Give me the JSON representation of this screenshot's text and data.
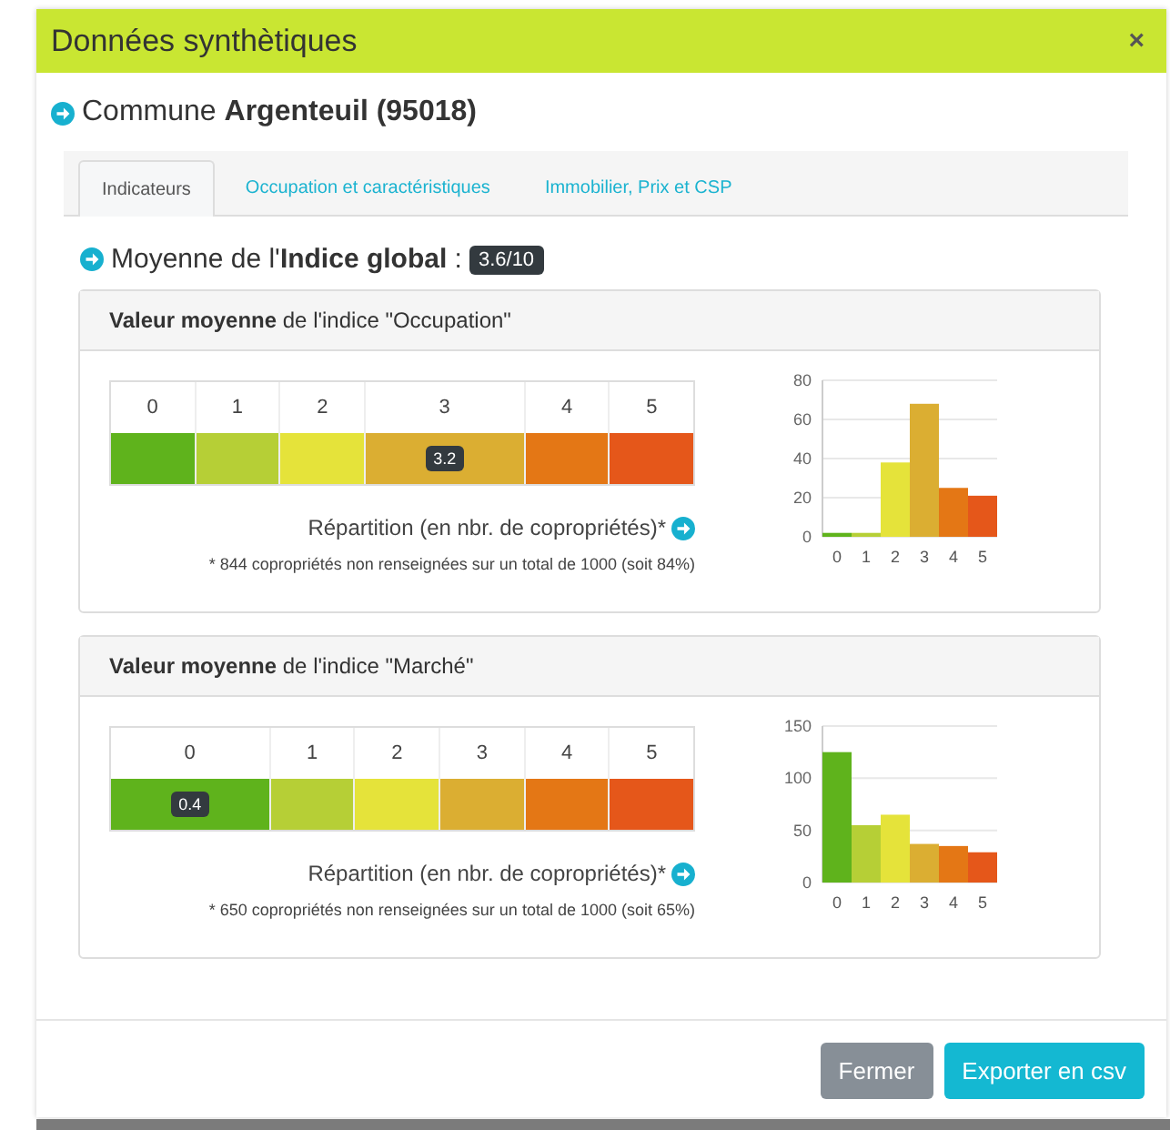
{
  "window": {
    "title": "Données synthètiques",
    "close": "×"
  },
  "commune": {
    "prefix": "Commune",
    "name": "Argenteuil (95018)"
  },
  "tabs": [
    {
      "label": "Indicateurs",
      "selected": true
    },
    {
      "label": "Occupation et caractéristiques",
      "selected": false
    },
    {
      "label": "Immobilier, Prix et CSP",
      "selected": false
    }
  ],
  "global": {
    "text": "Moyenne de l'**Indice global** :",
    "badge": "3.6/10"
  },
  "panels": [
    {
      "title": "**Valeur moyenne** de l'indice \"Occupation\"",
      "marker": "3.2",
      "cells": [
        {
          "label": "0",
          "color": "#5fb31c",
          "selected": false
        },
        {
          "label": "1",
          "color": "#b6cf36",
          "selected": false
        },
        {
          "label": "2",
          "color": "#e5e33a",
          "selected": false
        },
        {
          "label": "3",
          "color": "#dbae32",
          "selected": true
        },
        {
          "label": "4",
          "color": "#e47715",
          "selected": false
        },
        {
          "label": "5",
          "color": "#e5571a",
          "selected": false
        }
      ],
      "link": "Répartition (en nbr. de copropriétés)*",
      "note": "* 844 copropriétés non renseignées sur un total de 1000 (soit 84%)",
      "chart_data": {
        "type": "bar",
        "categories": [
          "0",
          "1",
          "2",
          "3",
          "4",
          "5"
        ],
        "series": [
          {
            "values": [
              2,
              2,
              38,
              68,
              25,
              21
            ]
          }
        ],
        "grid": true,
        "ylim": [
          0,
          80
        ],
        "yticks": [
          0,
          20,
          40,
          60,
          80
        ]
      }
    },
    {
      "title": "**Valeur moyenne** de l'indice \"Marché\"",
      "marker": "0.4",
      "cells": [
        {
          "label": "0",
          "color": "#5fb31c",
          "selected": true
        },
        {
          "label": "1",
          "color": "#b6cf36",
          "selected": false
        },
        {
          "label": "2",
          "color": "#e5e33a",
          "selected": false
        },
        {
          "label": "3",
          "color": "#dbae32",
          "selected": false
        },
        {
          "label": "4",
          "color": "#e47715",
          "selected": false
        },
        {
          "label": "5",
          "color": "#e5571a",
          "selected": false
        }
      ],
      "link": "Répartition (en nbr. de copropriétés)*",
      "note": "* 650 copropriétés non renseignées sur un total de 1000 (soit 65%)",
      "chart_data": {
        "type": "bar",
        "categories": [
          "0",
          "1",
          "2",
          "3",
          "4",
          "5"
        ],
        "series": [
          {
            "values": [
              125,
              55,
              65,
              37,
              35,
              29
            ]
          }
        ],
        "grid": true,
        "ylim": [
          0,
          150
        ],
        "yticks": [
          0,
          50,
          100,
          150
        ]
      }
    }
  ],
  "buttons": [
    {
      "label": "Fermer",
      "kind": "secondary"
    },
    {
      "label": "Exporter en csv",
      "kind": "primary"
    }
  ]
}
